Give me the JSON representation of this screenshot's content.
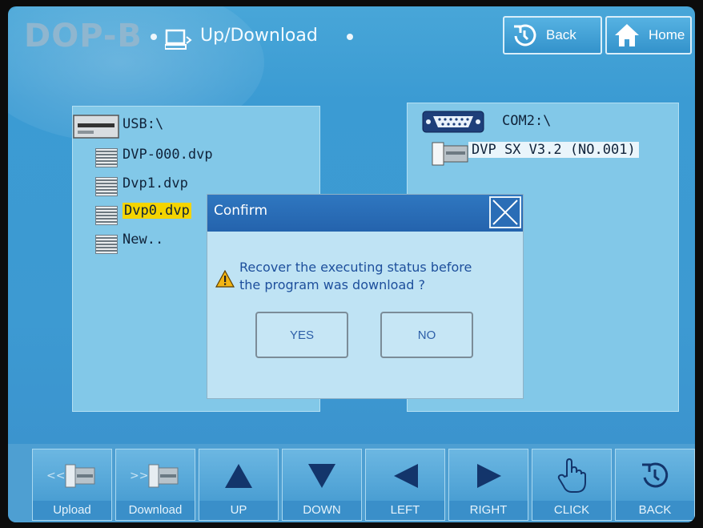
{
  "header": {
    "brand": "DOP-B",
    "screen_title": "Up/Download",
    "back_label": "Back",
    "home_label": "Home"
  },
  "left_panel": {
    "path": "USB:\\",
    "files": [
      {
        "name": "DVP-000.dvp",
        "selected": false
      },
      {
        "name": "Dvp1.dvp",
        "selected": false
      },
      {
        "name": "Dvp0.dvp",
        "selected": true
      },
      {
        "name": "New..",
        "selected": false
      }
    ]
  },
  "right_panel": {
    "path": "COM2:\\",
    "device": "DVP SX V3.2 (NO.001)"
  },
  "dialog": {
    "title": "Confirm",
    "message_line1": "Recover the executing status before",
    "message_line2": "the program was download ?",
    "yes_label": "YES",
    "no_label": "NO"
  },
  "toolbar": {
    "buttons": [
      "Upload",
      "Download",
      "UP",
      "DOWN",
      "LEFT",
      "RIGHT",
      "CLICK",
      "BACK"
    ]
  },
  "colors": {
    "background": "#3d9ad2",
    "panel": "#82c8e8",
    "selected_highlight": "#f4d400",
    "dialog_title_bar": "#2463ad",
    "message_text": "#1d4f9c"
  }
}
